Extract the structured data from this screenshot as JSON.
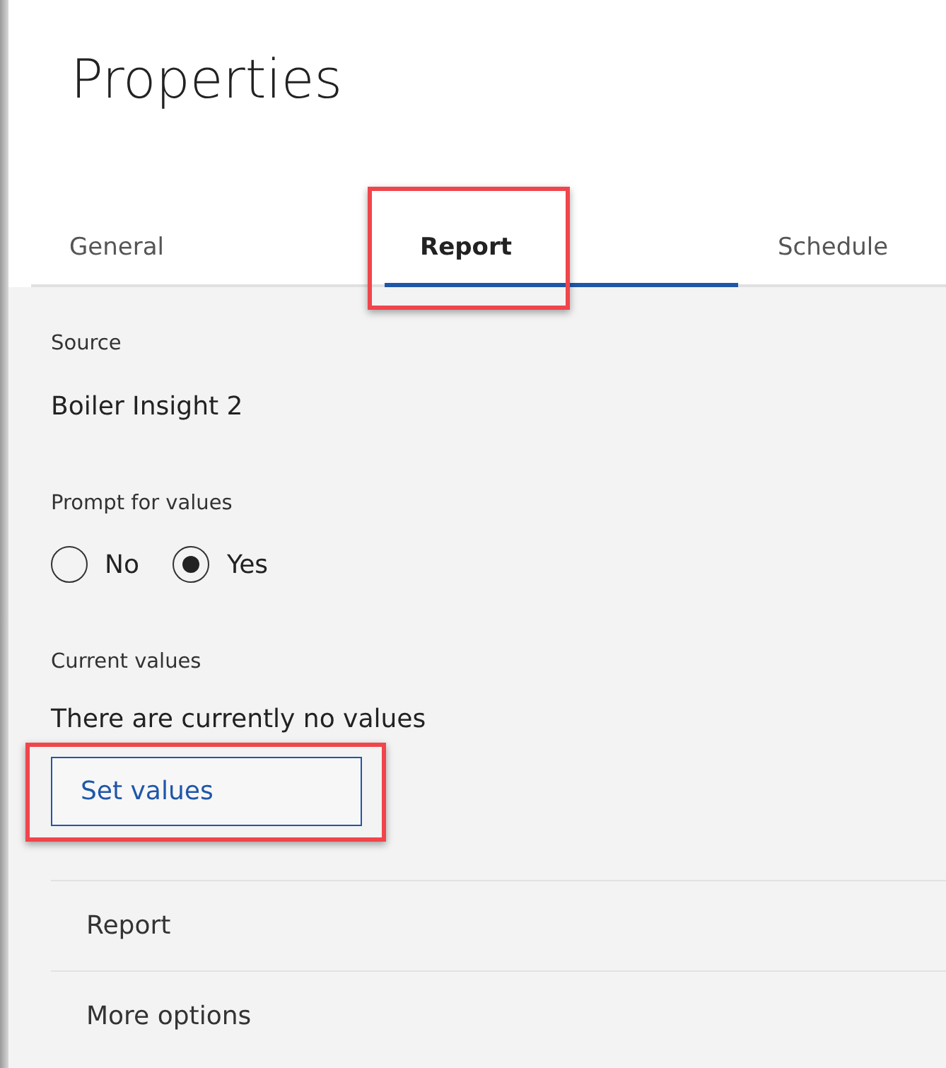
{
  "title": "Properties",
  "tabs": [
    {
      "label": "General",
      "selected": false,
      "highlighted": false
    },
    {
      "label": "Report",
      "selected": true,
      "highlighted": true
    },
    {
      "label": "Schedule",
      "selected": false,
      "highlighted": false
    }
  ],
  "source": {
    "label": "Source",
    "value": "Boiler Insight 2"
  },
  "prompt": {
    "label": "Prompt for values",
    "options": [
      {
        "label": "No",
        "selected": false
      },
      {
        "label": "Yes",
        "selected": true
      }
    ]
  },
  "current_values": {
    "label": "Current values",
    "text": "There are currently no values",
    "button": {
      "label": "Set values",
      "highlighted": true
    }
  },
  "sections": [
    {
      "label": "Report"
    },
    {
      "label": "More options"
    }
  ]
}
